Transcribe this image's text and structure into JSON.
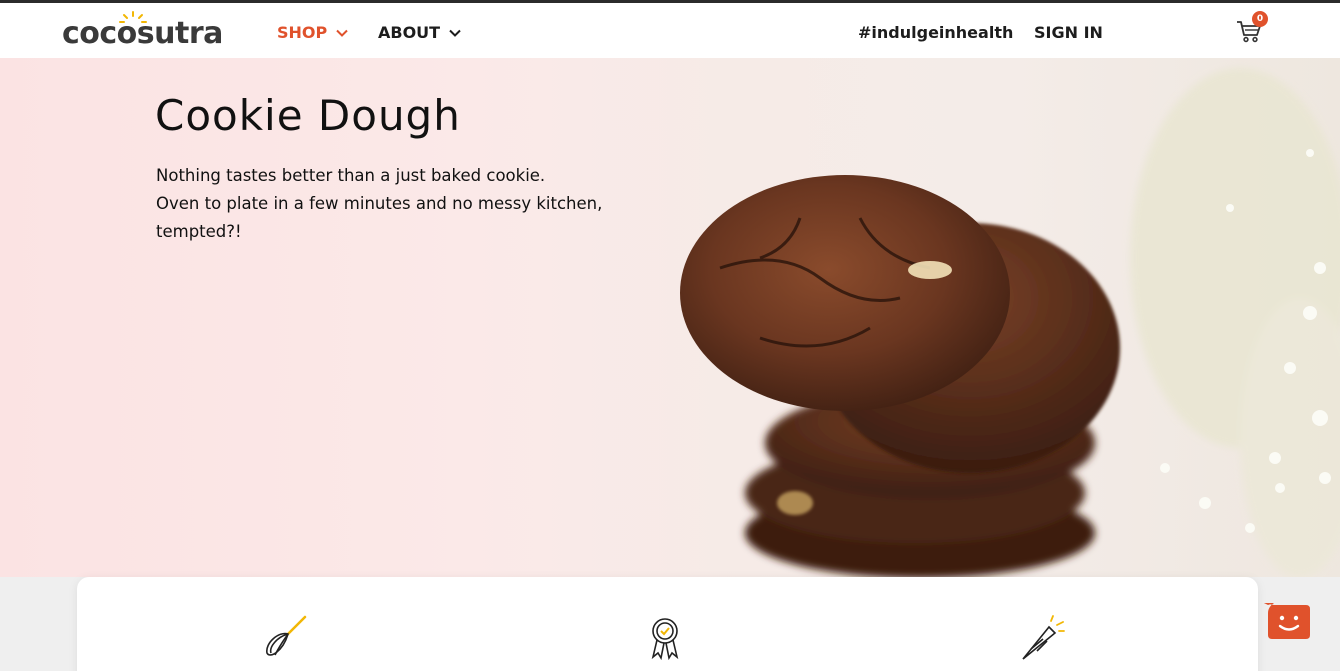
{
  "brand": {
    "name": "cocosutra",
    "accent_color": "#e0522c",
    "sun_color": "#f2b705"
  },
  "nav": {
    "shop_label": "SHOP",
    "about_label": "ABOUT",
    "hashtag_label": "#indulgeinhealth",
    "signin_label": "SIGN IN",
    "cart_count": "0"
  },
  "hero": {
    "title": "Cookie Dough",
    "lines": [
      "Nothing tastes better than a just baked cookie.",
      "Oven to plate in a few minutes and no messy kitchen,",
      "tempted?!"
    ],
    "image": "stacked-chocolate-cookies-with-baby-breath-flowers"
  },
  "features": {
    "icons": [
      "whisk-icon",
      "award-ribbon-icon",
      "party-popper-icon"
    ]
  },
  "chat": {
    "icon": "chat-smiley-icon",
    "color": "#e0522c"
  }
}
